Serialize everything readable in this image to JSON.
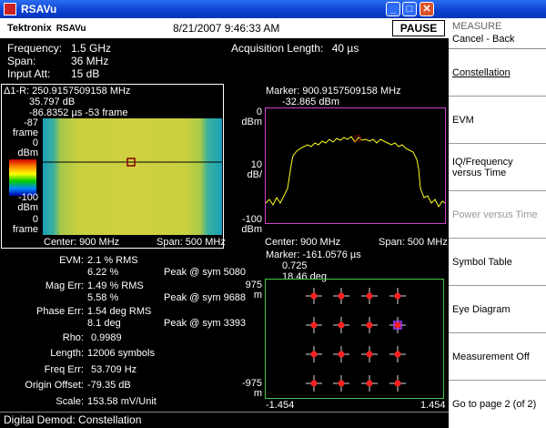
{
  "window": {
    "title": "RSAVu"
  },
  "header": {
    "brand": "Tektronix",
    "brand_sub": "RSAVu",
    "datetime": "8/21/2007 9:46:33 AM",
    "pause": "PAUSE"
  },
  "settings": {
    "frequency_label": "Frequency:",
    "frequency": "1.5 GHz",
    "span_label": "Span:",
    "span": "36 MHz",
    "input_att_label": "Input Att:",
    "input_att": "15 dB",
    "acq_label": "Acquisition Length:",
    "acq": "40 µs"
  },
  "spectrogram": {
    "line1": "Δ1-R: 250.9157509158 MHz",
    "line2": "35.797 dB",
    "line3": "-86.8352 µs  -53 frame",
    "y_top_val": "-87",
    "y_top_unit": "frame",
    "y_0": "0",
    "y_dbm": "dBm",
    "y_m100": "-100",
    "y_dbm2": "dBm",
    "y_bot_val": "0",
    "y_bot_unit": "frame",
    "center": "Center: 900 MHz",
    "span": "Span: 500 MHz"
  },
  "spectrum": {
    "marker": "Marker: 900.9157509158 MHz",
    "marker_val": "-32.865 dBm",
    "y_0": "0",
    "y_dbm": "dBm",
    "y_10": "10",
    "y_dbdiv": "dB/",
    "y_m100": "-100",
    "y_dbm2": "dBm",
    "center": "Center: 900 MHz",
    "span": "Span: 500 MHz"
  },
  "constellation": {
    "marker": "Marker: -161.0576 µs",
    "marker_val1": "0.725",
    "marker_val2": "18.46 deg",
    "y_top": "975",
    "y_top_unit": "m",
    "y_bot": "-975",
    "y_bot_unit": "m",
    "x_left": "-1.454",
    "x_right": "1.454"
  },
  "metrics": {
    "evm_label": "EVM:",
    "evm_rms": "2.1  % RMS",
    "evm_pct": "6.22 %",
    "evm_peak": "Peak @ sym 5080",
    "mag_label": "Mag Err:",
    "mag_rms": "1.49 % RMS",
    "mag_pct": "5.58 %",
    "mag_peak": "Peak @ sym 9688",
    "phase_label": "Phase Err:",
    "phase_rms": "1.54 deg RMS",
    "phase_deg": "8.1  deg",
    "phase_peak": "Peak @ sym 3393",
    "rho_label": "Rho:",
    "rho": "0.9989",
    "length_label": "Length:",
    "length": "12006 symbols",
    "freq_label": "Freq Err:",
    "freq": "53.709 Hz",
    "origin_label": "Origin Offset:",
    "origin": "-79.35 dB",
    "scale_label": "Scale:",
    "scale": "153.58  mV/Unit"
  },
  "status": "Digital Demod: Constellation",
  "sidemenu": {
    "header1": "MEASURE",
    "header2": "Cancel - Back",
    "items": [
      "Constellation",
      "EVM",
      "IQ/Frequency versus Time",
      "Power versus Time",
      "Symbol Table",
      "Eye Diagram",
      "Measurement Off",
      "Go to page 2 (of 2)"
    ]
  }
}
